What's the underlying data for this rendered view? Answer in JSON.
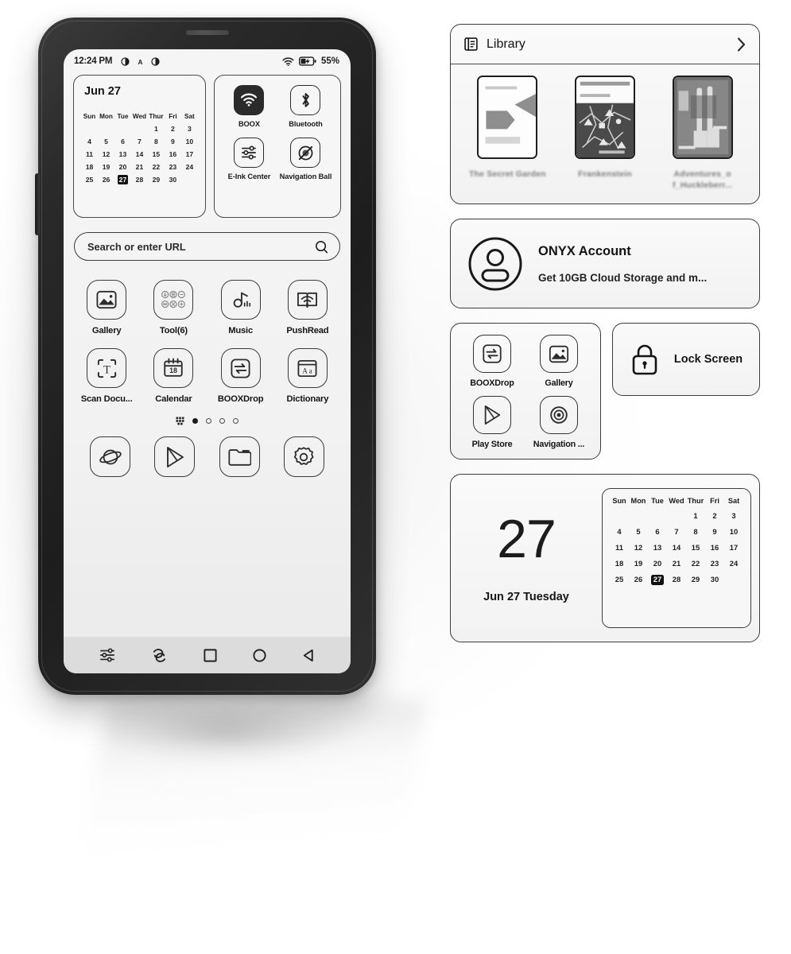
{
  "phone": {
    "statusbar": {
      "time": "12:24 PM",
      "icons": [
        "contrast-icon",
        "font-size-icon",
        "contrast-icon-2"
      ],
      "wifi": "wifi-icon",
      "battery": "battery-charging-icon",
      "battery_percent": "55%"
    },
    "calendar_widget": {
      "title": "Jun 27",
      "weekdays": [
        "Sun",
        "Mon",
        "Tue",
        "Wed",
        "Thur",
        "Fri",
        "Sat"
      ],
      "leading_blanks": 4,
      "days": [
        1,
        2,
        3,
        4,
        5,
        6,
        7,
        8,
        9,
        10,
        11,
        12,
        13,
        14,
        15,
        16,
        17,
        18,
        19,
        20,
        21,
        22,
        23,
        24,
        25,
        26,
        27,
        28,
        29,
        30
      ],
      "today": 27
    },
    "toggles_widget": {
      "items": [
        {
          "label": "BOOX",
          "icon": "wifi-icon",
          "active": true
        },
        {
          "label": "Bluetooth",
          "icon": "bluetooth-icon",
          "active": false
        },
        {
          "label": "E-Ink Center",
          "icon": "sliders-icon",
          "active": false
        },
        {
          "label": "Navigation Ball",
          "icon": "navigation-ball-off-icon",
          "active": false
        }
      ]
    },
    "search": {
      "placeholder": "Search or enter URL",
      "icon": "search-icon"
    },
    "apps": [
      {
        "label": "Gallery",
        "icon": "image-icon"
      },
      {
        "label": "Tool(6)",
        "icon": "folder-tools-icon"
      },
      {
        "label": "Music",
        "icon": "music-note-icon"
      },
      {
        "label": "PushRead",
        "icon": "push-read-icon"
      },
      {
        "label": "Scan Docu...",
        "icon": "scan-text-icon"
      },
      {
        "label": "Calendar",
        "icon": "calendar-18-icon"
      },
      {
        "label": "BOOXDrop",
        "icon": "transfer-arrows-icon"
      },
      {
        "label": "Dictionary",
        "icon": "dictionary-aa-icon"
      }
    ],
    "pager": {
      "grid_icon": "app-grid-icon",
      "total": 4,
      "active_index": 0
    },
    "dock": [
      {
        "label": "Browser",
        "icon": "planet-browser-icon"
      },
      {
        "label": "Play Store",
        "icon": "play-store-icon"
      },
      {
        "label": "Files",
        "icon": "folder-icon"
      },
      {
        "label": "Settings",
        "icon": "gear-icon"
      }
    ],
    "navbar": [
      {
        "label": "E-Ink Settings",
        "icon": "sliders-icon"
      },
      {
        "label": "Refresh",
        "icon": "refresh-swirl-icon"
      },
      {
        "label": "Recents",
        "icon": "square-icon"
      },
      {
        "label": "Home",
        "icon": "circle-icon"
      },
      {
        "label": "Back",
        "icon": "triangle-back-icon"
      }
    ]
  },
  "panel": {
    "library": {
      "title": "Library",
      "icon": "book-icon",
      "chevron": "chevron-right-icon",
      "books": [
        {
          "title": "The Secret\nGarden"
        },
        {
          "title": "Frankenstein"
        },
        {
          "title": "Adventures_o\nf_Huckleberr..."
        }
      ]
    },
    "account": {
      "icon": "account-avatar-icon",
      "title": "ONYX Account",
      "subtitle": "Get 10GB Cloud Storage and m..."
    },
    "apps_widget": [
      {
        "label": "BOOXDrop",
        "icon": "transfer-arrows-icon"
      },
      {
        "label": "Gallery",
        "icon": "image-icon"
      },
      {
        "label": "Play Store",
        "icon": "play-store-icon"
      },
      {
        "label": "Navigation ...",
        "icon": "navigation-ball-icon"
      }
    ],
    "lock_screen": {
      "label": "Lock Screen",
      "icon": "lock-icon"
    },
    "calendar_widget": {
      "day_number": "27",
      "day_label": "Jun 27 Tuesday",
      "weekdays": [
        "Sun",
        "Mon",
        "Tue",
        "Wed",
        "Thur",
        "Fri",
        "Sat"
      ],
      "leading_blanks": 4,
      "days": [
        1,
        2,
        3,
        4,
        5,
        6,
        7,
        8,
        9,
        10,
        11,
        12,
        13,
        14,
        15,
        16,
        17,
        18,
        19,
        20,
        21,
        22,
        23,
        24,
        25,
        26,
        27,
        28,
        29,
        30
      ],
      "today": 27
    }
  },
  "colors": {
    "ink": "#1b1b1b",
    "screen_bg": "#f3f3f3",
    "accent_dark": "#2b2b2b",
    "bezel": "#222222"
  }
}
